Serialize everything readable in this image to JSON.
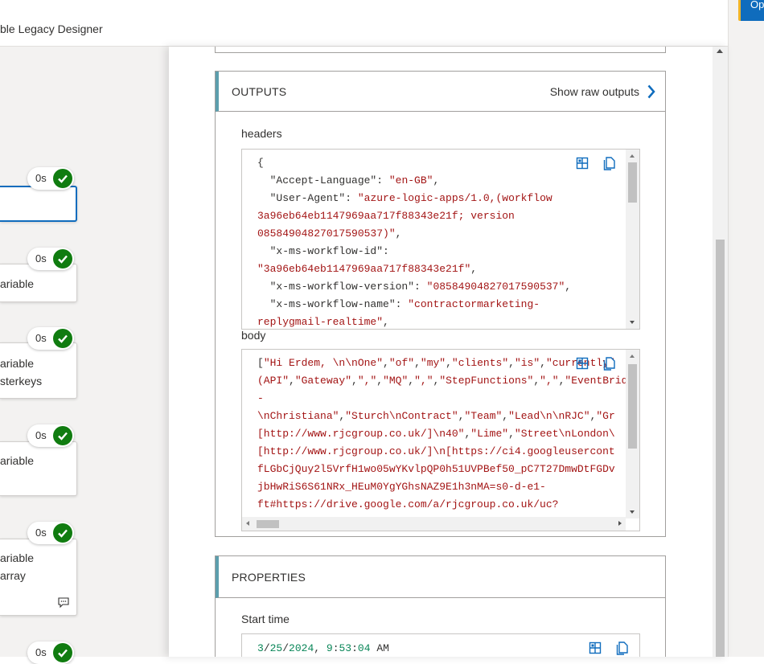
{
  "app": {
    "title": "ble Legacy Designer",
    "top_action_label": "Op"
  },
  "colors": {
    "accent": "#0f6cbd",
    "success": "#107c10",
    "section_bar": "#5c9ead",
    "json_string": "#a31515",
    "json_number": "#098658"
  },
  "canvas": {
    "steps": [
      {
        "duration": "0s",
        "line1": "",
        "line2": "",
        "status_icon": "check-circle-icon"
      },
      {
        "duration": "0s",
        "line1": "ariable",
        "line2": "",
        "status_icon": "check-circle-icon"
      },
      {
        "duration": "0s",
        "line1": "ariable",
        "line2": "sterkeys",
        "status_icon": "check-circle-icon"
      },
      {
        "duration": "0s",
        "line1": "ariable",
        "line2": "",
        "status_icon": "check-circle-icon"
      },
      {
        "duration": "0s",
        "line1": "ariable",
        "line2": "array",
        "status_icon": "check-circle-icon",
        "extra_icon": "comment-icon"
      },
      {
        "duration": "0s",
        "line1": "",
        "line2": "",
        "status_icon": "check-circle-icon"
      }
    ]
  },
  "outputs": {
    "title": "OUTPUTS",
    "raw_link": "Show raw outputs",
    "headers_label": "headers",
    "headers_lines": [
      [
        {
          "t": "p",
          "v": "{"
        }
      ],
      [
        {
          "t": "p",
          "v": "  "
        },
        {
          "t": "k",
          "v": "\"Accept-Language\""
        },
        {
          "t": "p",
          "v": ": "
        },
        {
          "t": "s",
          "v": "\"en-GB\""
        },
        {
          "t": "p",
          "v": ","
        }
      ],
      [
        {
          "t": "p",
          "v": "  "
        },
        {
          "t": "k",
          "v": "\"User-Agent\""
        },
        {
          "t": "p",
          "v": ": "
        },
        {
          "t": "s",
          "v": "\"azure-logic-apps/1.0,(workflow"
        }
      ],
      [
        {
          "t": "s",
          "v": "3a96eb64eb1147969aa717f88343e21f; version"
        }
      ],
      [
        {
          "t": "s",
          "v": "08584904827017590537)\""
        },
        {
          "t": "p",
          "v": ","
        }
      ],
      [
        {
          "t": "p",
          "v": "  "
        },
        {
          "t": "k",
          "v": "\"x-ms-workflow-id\""
        },
        {
          "t": "p",
          "v": ":"
        }
      ],
      [
        {
          "t": "s",
          "v": "\"3a96eb64eb1147969aa717f88343e21f\""
        },
        {
          "t": "p",
          "v": ","
        }
      ],
      [
        {
          "t": "p",
          "v": "  "
        },
        {
          "t": "k",
          "v": "\"x-ms-workflow-version\""
        },
        {
          "t": "p",
          "v": ": "
        },
        {
          "t": "s",
          "v": "\"08584904827017590537\""
        },
        {
          "t": "p",
          "v": ","
        }
      ],
      [
        {
          "t": "p",
          "v": "  "
        },
        {
          "t": "k",
          "v": "\"x-ms-workflow-name\""
        },
        {
          "t": "p",
          "v": ": "
        },
        {
          "t": "s",
          "v": "\"contractormarketing-"
        }
      ],
      [
        {
          "t": "s",
          "v": "replygmail-realtime\""
        },
        {
          "t": "p",
          "v": ","
        }
      ]
    ],
    "body_label": "body",
    "body_lines": [
      [
        {
          "t": "p",
          "v": "["
        },
        {
          "t": "s",
          "v": "\"Hi Erdem, \\n\\nOne\""
        },
        {
          "t": "p",
          "v": ","
        },
        {
          "t": "s",
          "v": "\"of\""
        },
        {
          "t": "p",
          "v": ","
        },
        {
          "t": "s",
          "v": "\"my\""
        },
        {
          "t": "p",
          "v": ","
        },
        {
          "t": "s",
          "v": "\"clients\""
        },
        {
          "t": "p",
          "v": ","
        },
        {
          "t": "s",
          "v": "\"is\""
        },
        {
          "t": "p",
          "v": ","
        },
        {
          "t": "s",
          "v": "\"currently\""
        }
      ],
      [
        {
          "t": "s",
          "v": "(API\""
        },
        {
          "t": "p",
          "v": ","
        },
        {
          "t": "s",
          "v": "\"Gateway\""
        },
        {
          "t": "p",
          "v": ","
        },
        {
          "t": "s",
          "v": "\",\""
        },
        {
          "t": "p",
          "v": ","
        },
        {
          "t": "s",
          "v": "\"MQ\""
        },
        {
          "t": "p",
          "v": ","
        },
        {
          "t": "s",
          "v": "\",\""
        },
        {
          "t": "p",
          "v": ","
        },
        {
          "t": "s",
          "v": "\"StepFunctions\""
        },
        {
          "t": "p",
          "v": ","
        },
        {
          "t": "s",
          "v": "\",\""
        },
        {
          "t": "p",
          "v": ","
        },
        {
          "t": "s",
          "v": "\"EventBridge)\\n\""
        },
        {
          "t": "p",
          "v": ","
        }
      ],
      [
        {
          "t": "s",
          "v": "-"
        }
      ],
      [
        {
          "t": "s",
          "v": "\\nChristiana\""
        },
        {
          "t": "p",
          "v": ","
        },
        {
          "t": "s",
          "v": "\"Sturch\\nContract\""
        },
        {
          "t": "p",
          "v": ","
        },
        {
          "t": "s",
          "v": "\"Team\""
        },
        {
          "t": "p",
          "v": ","
        },
        {
          "t": "s",
          "v": "\"Lead\\n\\nRJC\""
        },
        {
          "t": "p",
          "v": ","
        },
        {
          "t": "s",
          "v": "\"Gr"
        }
      ],
      [
        {
          "t": "s",
          "v": "[http://www.rjcgroup.co.uk/]\\n40\""
        },
        {
          "t": "p",
          "v": ","
        },
        {
          "t": "s",
          "v": "\"Lime\""
        },
        {
          "t": "p",
          "v": ","
        },
        {
          "t": "s",
          "v": "\"Street\\nLondon\\"
        }
      ],
      [
        {
          "t": "s",
          "v": "[http://www.rjcgroup.co.uk/]\\n[https://ci4.googleusercont"
        }
      ],
      [
        {
          "t": "s",
          "v": "fLGbCjQuy2l5VrfH1wo05wYKvlpQP0h51UVPBef50_pC7T27DmwDtFGDv"
        }
      ],
      [
        {
          "t": "s",
          "v": "jbHwRiS6S61NRx_HEuM0YgYGhsNAZ9E1h3nMA=s0-d-e1-"
        }
      ],
      [
        {
          "t": "s",
          "v": "ft#https://drive.google.com/a/rjcgroup.co.uk/uc?"
        }
      ]
    ]
  },
  "properties": {
    "title": "PROPERTIES",
    "start_time_label": "Start time",
    "start_time_parts": [
      {
        "t": "n",
        "v": "3"
      },
      {
        "t": "p",
        "v": "/"
      },
      {
        "t": "n",
        "v": "25"
      },
      {
        "t": "p",
        "v": "/"
      },
      {
        "t": "n",
        "v": "2024"
      },
      {
        "t": "p",
        "v": ", "
      },
      {
        "t": "n",
        "v": "9"
      },
      {
        "t": "p",
        "v": ":"
      },
      {
        "t": "n",
        "v": "53"
      },
      {
        "t": "p",
        "v": ":"
      },
      {
        "t": "n",
        "v": "04"
      },
      {
        "t": "p",
        "v": " AM"
      }
    ]
  }
}
